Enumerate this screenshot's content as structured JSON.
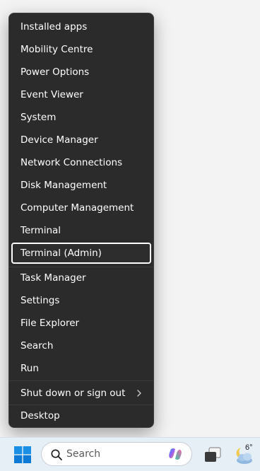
{
  "menu": {
    "items": [
      {
        "label": "Installed apps"
      },
      {
        "label": "Mobility Centre"
      },
      {
        "label": "Power Options"
      },
      {
        "label": "Event Viewer"
      },
      {
        "label": "System"
      },
      {
        "label": "Device Manager"
      },
      {
        "label": "Network Connections"
      },
      {
        "label": "Disk Management"
      },
      {
        "label": "Computer Management"
      },
      {
        "label": "Terminal"
      },
      {
        "label": "Terminal (Admin)"
      },
      {
        "label": "Task Manager"
      },
      {
        "label": "Settings"
      },
      {
        "label": "File Explorer"
      },
      {
        "label": "Search"
      },
      {
        "label": "Run"
      },
      {
        "label": "Shut down or sign out"
      },
      {
        "label": "Desktop"
      }
    ],
    "focused_item": "Terminal (Admin)",
    "submenu_icon": "chevron-right-icon"
  },
  "taskbar": {
    "search_placeholder": "Search",
    "search_icon": "search-icon",
    "start_icon": "windows-logo-icon",
    "copilot_icon": "copilot-icon",
    "taskview_icon": "task-view-icon",
    "weather_icon": "cloudy-night-icon",
    "weather_temp": "6°"
  },
  "colors": {
    "menu_bg": "#2b2b2b",
    "menu_text": "#ffffff",
    "focus_border": "#ffffff",
    "taskbar_bg": "#e6eef6",
    "windows_blue": "#0078d4"
  }
}
